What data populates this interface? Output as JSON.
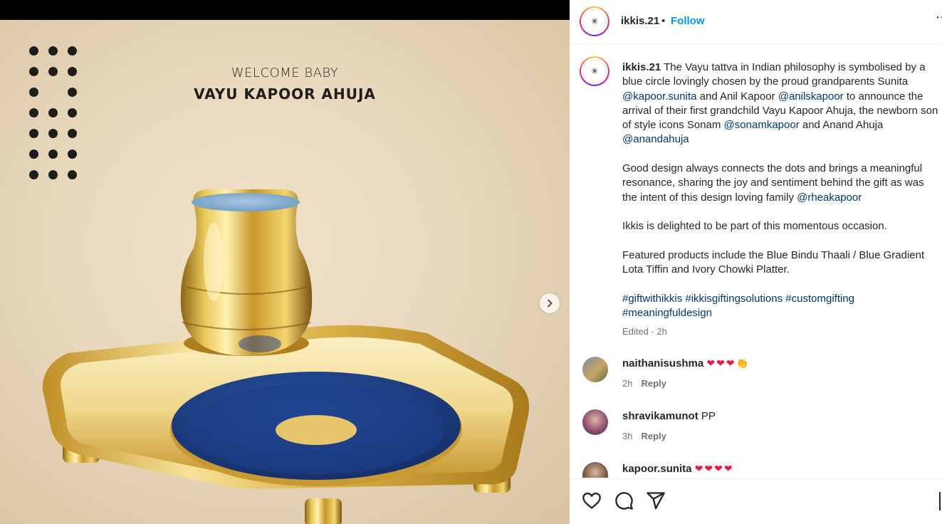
{
  "post_image": {
    "headline_line1": "WELCOME BABY",
    "headline_line2": "VAYU KAPOOR AHUJA",
    "dots_pattern": "3x7 dot grid with one missing dot"
  },
  "header": {
    "username": "ikkis.21",
    "separator": "•",
    "follow_label": "Follow",
    "more_label": "⋯"
  },
  "caption": {
    "username": "ikkis.21",
    "p1_a": " The Vayu tattva in Indian philosophy is symbolised by a blue circle lovingly chosen by the proud grandparents Sunita ",
    "p1_m1": "@kapoor.sunita",
    "p1_b": " and Anil Kapoor ",
    "p1_m2": "@anilskapoor",
    "p1_c": " to announce the arrival of their first grandchild Vayu Kapoor Ahuja, the newborn son of style icons Sonam ",
    "p1_m3": "@sonamkapoor",
    "p1_d": " and Anand Ahuja ",
    "p1_m4": "@anandahuja",
    "p2_a": "Good design always connects the dots and brings a meaningful resonance, sharing the joy and sentiment behind the gift as was the intent of this design loving family ",
    "p2_m1": "@rheakapoor",
    "p3": "Ikkis is delighted to be part of this momentous occasion.",
    "p4": "Featured products include the Blue Bindu Thaali / Blue Gradient Lota Tiffin and Ivory Chowki Platter.",
    "hashtags": [
      "#giftwithikkis",
      "#ikkisgiftingsolutions",
      "#customgifting",
      "#meaningfuldesign"
    ],
    "edited": "Edited · 2h"
  },
  "comments": [
    {
      "username": "naithanisushma",
      "text": "",
      "emoji": "❤❤❤👏",
      "time": "2h",
      "reply_label": "Reply"
    },
    {
      "username": "shravikamunot",
      "text": "PP",
      "emoji": "",
      "time": "3h",
      "reply_label": "Reply"
    },
    {
      "username": "kapoor.sunita",
      "text": "",
      "emoji": "❤❤❤❤",
      "time": "",
      "reply_label": ""
    }
  ],
  "actions": {
    "like_icon": "heart-icon",
    "comment_icon": "comment-icon",
    "share_icon": "share-icon"
  },
  "colors": {
    "accent_blue": "#0095f6",
    "link_blue": "#00376b",
    "heart_red": "#e41e3f",
    "gold": "#d4a82a",
    "plate_blue": "#1f3f86"
  }
}
